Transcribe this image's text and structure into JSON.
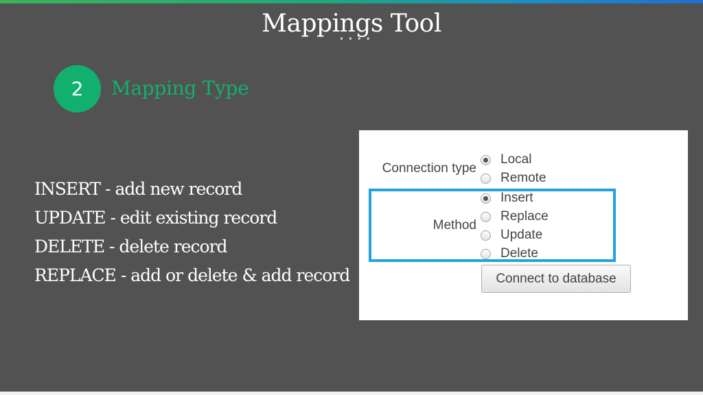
{
  "slide": {
    "title": "Mappings Tool",
    "title_dots": "• • • •",
    "step_number": "2",
    "step_label": "Mapping Type",
    "descriptions": [
      "INSERT - add new record",
      "UPDATE - edit existing record",
      "DELETE - delete record",
      "REPLACE - add or delete & add record"
    ]
  },
  "form": {
    "connection_type_label": "Connection type",
    "connection_options": [
      {
        "label": "Local",
        "checked": true
      },
      {
        "label": "Remote",
        "checked": false
      }
    ],
    "method_label": "Method",
    "method_options": [
      {
        "label": "Insert",
        "checked": true
      },
      {
        "label": "Replace",
        "checked": false
      },
      {
        "label": "Update",
        "checked": false
      },
      {
        "label": "Delete",
        "checked": false
      }
    ],
    "connect_button_label": "Connect to database"
  },
  "colors": {
    "slide_background": "#525252",
    "accent_green": "#12b06e",
    "highlight_blue": "#1fa3e0"
  }
}
